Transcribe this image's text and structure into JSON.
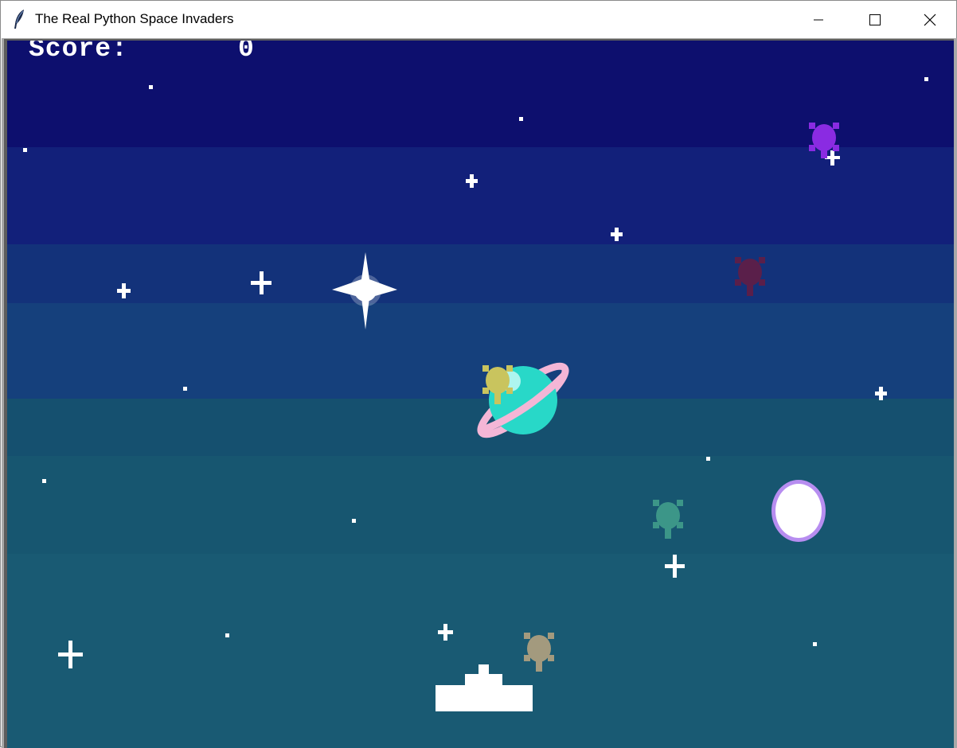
{
  "window": {
    "title": "The Real Python Space Invaders",
    "icon": "feather-icon",
    "controls": [
      "minimize-icon",
      "maximize-icon",
      "close-icon"
    ]
  },
  "game": {
    "score_label": "Score:",
    "score_value": "0",
    "invader_colors": [
      "#8a2be2",
      "#5a1f4a",
      "#c9c45e",
      "#3c9688",
      "#a39a7e"
    ],
    "player_color": "#ffffff",
    "planet_colors": {
      "body": "#28d8c8",
      "ring": "#f4b6d6"
    },
    "moon_colors": {
      "core": "#ffffff",
      "halo": "#b78df0"
    }
  }
}
